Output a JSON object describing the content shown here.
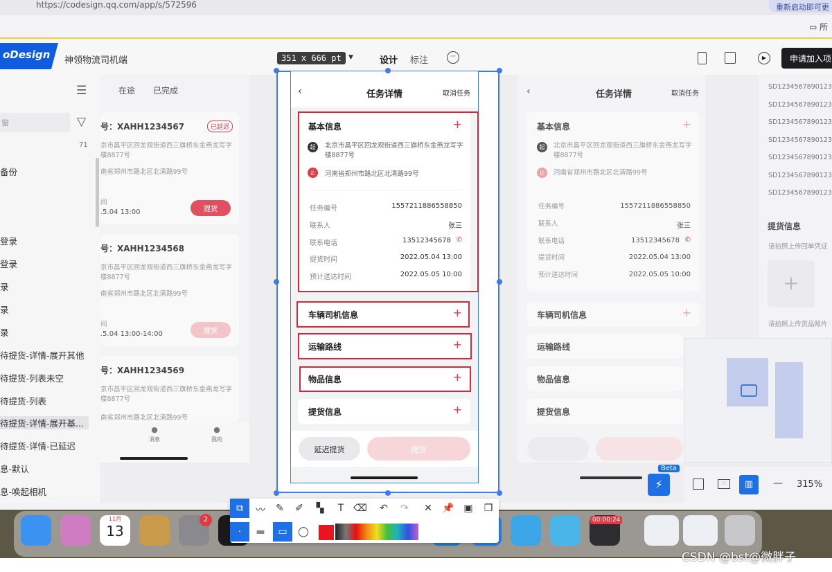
{
  "browser": {
    "url": "https://codesign.qq.com/app/s/572596",
    "right_button": "重新启动即可更",
    "bookmark": "所"
  },
  "app": {
    "logo": "oDesign",
    "project_name": "神领物流司机端",
    "size_badge": "351 x 666 pt",
    "tab_design": "设计",
    "tab_annotate": "标注",
    "apply_button": "申请加入项"
  },
  "sidebar": {
    "items": [
      "备份",
      "登录",
      "登录",
      "录",
      "录",
      "录",
      "待提货-详情-展开其他",
      "待提货-列表未空",
      "待提货-列表",
      "待提货-详情-展开基...",
      "待提货-详情-已延迟",
      "息-默认",
      "息-唤起相机"
    ],
    "count": "71"
  },
  "list": {
    "tabs": [
      "在途",
      "已完成"
    ],
    "cards": [
      {
        "title": "号：XAHH1234567",
        "badge": "已延迟",
        "addr1": "京市昌平区回龙观街道西三旗桥东金燕龙写字楼8877号",
        "addr2": "南省郑州市路北区北清路99号",
        "date_label": "间",
        "time": ".5.04 13:00",
        "button": "提货"
      },
      {
        "title": "号：XAHH1234568",
        "addr1": "京市昌平区回龙观街道西三旗桥东金燕龙写字楼8877号",
        "addr2": "南省郑州市路北区北清路99号",
        "date_label": "间",
        "time": ".5.04 13:00-14:00",
        "button": "提货"
      },
      {
        "title": "号：XAHH1234569",
        "addr1": "京市昌平区回龙观街道西三旗桥东金燕龙写字楼8877号",
        "addr2": "南省郑州市路北区北清路99号"
      }
    ],
    "bottom_nav": [
      "消息",
      "我的"
    ]
  },
  "detail": {
    "title": "任务详情",
    "cancel": "取消任务",
    "basic_title": "基本信息",
    "from_badge": "起",
    "to_badge": "止",
    "from_address": "北京市昌平区回龙观街道西三旗桥东金燕龙写字楼8877号",
    "to_address": "河南省郑州市路北区北清路99号",
    "rows": [
      {
        "label": "任务编号",
        "value": "1557211886558850"
      },
      {
        "label": "联系人",
        "value": "张三"
      },
      {
        "label": "联系电话",
        "value": "13512345678"
      },
      {
        "label": "提货时间",
        "value": "2022.05.04 13:00"
      },
      {
        "label": "预计送达时间",
        "value": "2022.05.05 10:00"
      }
    ],
    "sections": [
      "车辆司机信息",
      "运输路线",
      "物品信息",
      "提货信息"
    ],
    "delay_button": "延迟提货",
    "pickup_button": "提货"
  },
  "right": {
    "ids": [
      "SD1234567890123",
      "SD1234567890123",
      "SD1234567890123",
      "SD1234567890123",
      "SD1234567890123",
      "SD1234567890123",
      "SD1234567890123"
    ],
    "pickup_title": "提货信息",
    "upload1": "请拍照上传回单凭证",
    "upload2": "请拍照上传货品照片",
    "beta": "Beta",
    "zoom": "315%"
  },
  "toolbar": {
    "record_time": "00:00:24"
  },
  "dock": {
    "calendar_month": "11月",
    "calendar_day": "13",
    "settings_badge": "2"
  },
  "watermark": "CSDN @bst@微胖子",
  "colors": {
    "accent": "#0f5dde",
    "red": "#e03a45",
    "selection": "#3f7ae8"
  }
}
